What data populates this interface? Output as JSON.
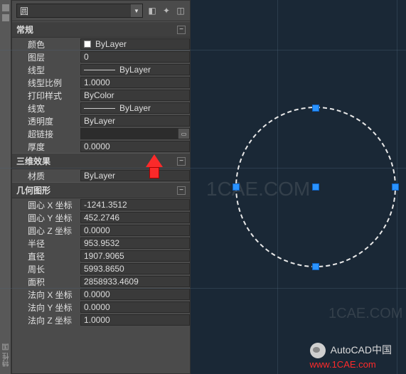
{
  "header": {
    "object_type": "圆"
  },
  "sections": {
    "general": {
      "title": "常规",
      "rows": {
        "color": {
          "label": "颜色",
          "value": "ByLayer"
        },
        "layer": {
          "label": "图层",
          "value": "0"
        },
        "linetype": {
          "label": "线型",
          "value": "ByLayer"
        },
        "ltscale": {
          "label": "线型比例",
          "value": "1.0000"
        },
        "plotstyle": {
          "label": "打印样式",
          "value": "ByColor"
        },
        "lineweight": {
          "label": "线宽",
          "value": "ByLayer"
        },
        "transparency": {
          "label": "透明度",
          "value": "ByLayer"
        },
        "hyperlink": {
          "label": "超链接",
          "value": ""
        },
        "thickness": {
          "label": "厚度",
          "value": "0.0000"
        }
      }
    },
    "threeD": {
      "title": "三维效果",
      "rows": {
        "material": {
          "label": "材质",
          "value": "ByLayer"
        }
      }
    },
    "geometry": {
      "title": "几何图形",
      "rows": {
        "cx": {
          "label": "圆心 X 坐标",
          "value": "-1241.3512"
        },
        "cy": {
          "label": "圆心 Y 坐标",
          "value": "452.2746"
        },
        "cz": {
          "label": "圆心 Z 坐标",
          "value": "0.0000"
        },
        "radius": {
          "label": "半径",
          "value": "953.9532"
        },
        "diameter": {
          "label": "直径",
          "value": "1907.9065"
        },
        "circumference": {
          "label": "周长",
          "value": "5993.8650"
        },
        "area": {
          "label": "面积",
          "value": "2858933.4609"
        },
        "nx": {
          "label": "法向 X 坐标",
          "value": "0.0000"
        },
        "ny": {
          "label": "法向 Y 坐标",
          "value": "0.0000"
        },
        "nz": {
          "label": "法向 Z 坐标",
          "value": "1.0000"
        }
      }
    }
  },
  "leftrail": {
    "b1": "特性",
    "b2": "国"
  },
  "watermarks": {
    "w1": "1CAE.COM",
    "w2": "1CAE.COM"
  },
  "footer": {
    "brand": "AutoCAD中国",
    "site": "www.1CAE.com"
  }
}
